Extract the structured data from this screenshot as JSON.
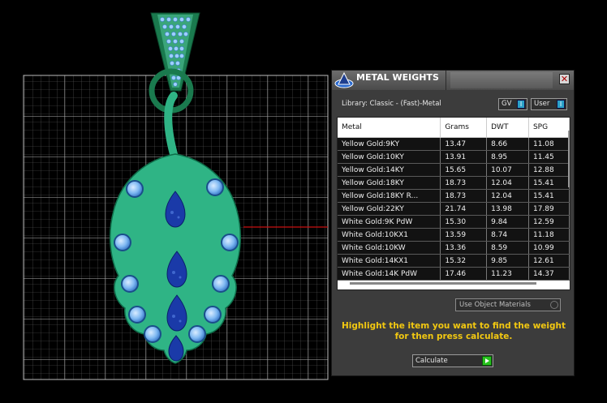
{
  "panel": {
    "title": "METAL WEIGHTS",
    "close_glyph": "✕",
    "library_label": "Library: Classic - (Fast)-Metal",
    "gv_label": "GV",
    "user_label": "User",
    "toggle_glyph": "I",
    "use_object_label": "Use Object Materials",
    "hint_line1": "Highlight the item you want to find the weight",
    "hint_line2": "for then press calculate.",
    "calculate_label": "Calculate"
  },
  "table": {
    "headers": [
      "Metal",
      "Grams",
      "DWT",
      "SPG"
    ],
    "rows": [
      [
        "Yellow Gold:9KY",
        "13.47",
        "8.66",
        "11.08"
      ],
      [
        "Yellow Gold:10KY",
        "13.91",
        "8.95",
        "11.45"
      ],
      [
        "Yellow Gold:14KY",
        "15.65",
        "10.07",
        "12.88"
      ],
      [
        "Yellow Gold:18KY",
        "18.73",
        "12.04",
        "15.41"
      ],
      [
        "Yellow Gold:18KY R...",
        "18.73",
        "12.04",
        "15.41"
      ],
      [
        "Yellow Gold:22KY",
        "21.74",
        "13.98",
        "17.89"
      ],
      [
        "White Gold:9K PdW",
        "15.30",
        "9.84",
        "12.59"
      ],
      [
        "White Gold:10KX1",
        "13.59",
        "8.74",
        "11.18"
      ],
      [
        "White Gold:10KW",
        "13.36",
        "8.59",
        "10.99"
      ],
      [
        "White Gold:14KX1",
        "15.32",
        "9.85",
        "12.61"
      ],
      [
        "White Gold:14K PdW",
        "17.46",
        "11.23",
        "14.37"
      ]
    ]
  },
  "colors": {
    "grid": "#9a9a9a",
    "leaf": "#2fb485",
    "leaf_dark": "#0f6e4a",
    "bail": "#1a7a4e",
    "sapphire": "#1a3aa8",
    "accent_gold": "#f2c811",
    "red_axis": "#c81010"
  },
  "icons": [
    "app-logo-icon",
    "close-icon",
    "toggle-icon",
    "checkbox-icon",
    "play-arrow-icon"
  ]
}
